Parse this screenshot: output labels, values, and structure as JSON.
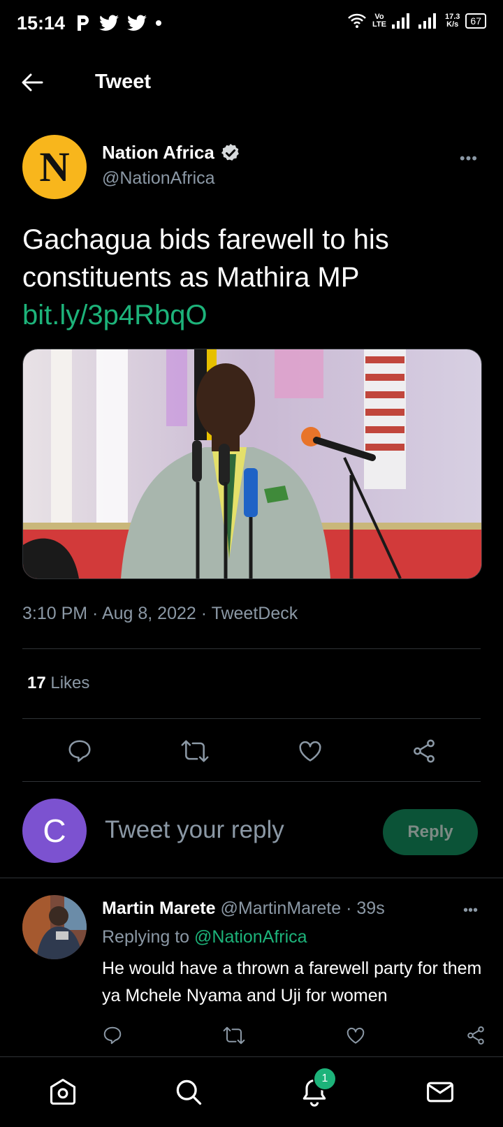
{
  "status_bar": {
    "time": "15:14",
    "network_top": "Vo",
    "network_bottom": "LTE",
    "speed_top": "17.3",
    "speed_bottom": "K/s",
    "battery": "67"
  },
  "header": {
    "title": "Tweet"
  },
  "tweet": {
    "author_name": "Nation Africa",
    "author_handle": "@NationAfrica",
    "avatar_letter": "N",
    "text": "Gachagua bids farewell to his constituents as Mathira MP",
    "link": "bit.ly/3p4RbqO",
    "time": "3:10 PM",
    "date": "Aug 8, 2022",
    "source": "TweetDeck",
    "likes_count": "17",
    "likes_label": "Likes"
  },
  "reply_box": {
    "avatar_letter": "C",
    "placeholder": "Tweet your reply",
    "button_label": "Reply"
  },
  "reply": {
    "name": "Martin Marete",
    "handle": "@MartinMarete",
    "age": "· 39s",
    "replying_prefix": "Replying to",
    "replying_to": "@NationAfrica",
    "text": "He would have a thrown a farewell party for them ya Mchele Nyama and Uji for women"
  },
  "nav": {
    "notifications_badge": "1"
  },
  "colors": {
    "accent": "#1db37a",
    "muted": "#8b98a5",
    "avatar_n": "#f8b61c",
    "avatar_c": "#7c52d0"
  }
}
